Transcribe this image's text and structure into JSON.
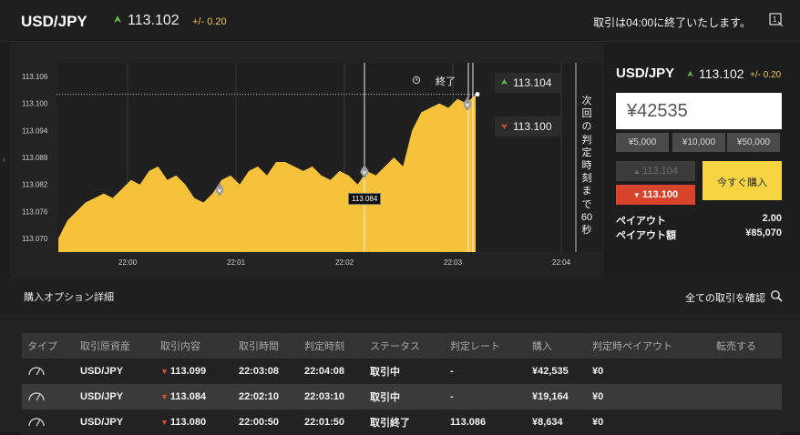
{
  "header": {
    "pair": "USD/JPY",
    "price": "113.102",
    "change": "+/- 0.20",
    "notice": "取引は04:00に終了いたします。",
    "expand_icon": "expand-icon"
  },
  "chart": {
    "y_ticks": [
      "113.106",
      "113.100",
      "113.094",
      "113.088",
      "113.082",
      "113.076",
      "113.070"
    ],
    "x_ticks": [
      "22:00",
      "22:01",
      "22:02",
      "22:03",
      "22:04"
    ],
    "end_label": "終了",
    "high_price": "113.104",
    "low_price": "113.100",
    "countdown": "次回の判定時刻まで60秒",
    "tooltip": "113.084",
    "colors": {
      "area": "#f5c23a",
      "up": "#5cc24a",
      "down": "#e0472f"
    }
  },
  "chart_data": {
    "type": "area",
    "x_range": [
      "22:00",
      "22:04"
    ],
    "ylim": [
      113.067,
      113.109
    ],
    "y_ticks": [
      113.106,
      113.1,
      113.094,
      113.088,
      113.082,
      113.076,
      113.07
    ],
    "x_ticks": [
      "22:00",
      "22:01",
      "22:02",
      "22:03",
      "22:04"
    ],
    "series": [
      {
        "values": [
          113.07,
          113.074,
          113.076,
          113.078,
          113.079,
          113.08,
          113.079,
          113.081,
          113.083,
          113.082,
          113.085,
          113.086,
          113.083,
          113.084,
          113.082,
          113.079,
          113.078,
          113.08,
          113.083,
          113.084,
          113.082,
          113.085,
          113.086,
          113.084,
          113.087,
          113.087,
          113.086,
          113.085,
          113.086,
          113.084,
          113.083,
          113.085,
          113.084,
          113.082,
          113.085,
          113.084,
          113.086,
          113.088,
          113.086,
          113.094,
          113.098,
          113.099,
          113.1,
          113.099,
          113.101,
          113.1,
          113.102
        ]
      }
    ],
    "entry_markers": [
      {
        "time": "22:00:50",
        "rate": 113.08,
        "direction": "low"
      },
      {
        "time": "22:02:10",
        "rate": 113.084,
        "direction": "low"
      },
      {
        "time": "22:03:08",
        "rate": 113.099,
        "direction": "low"
      }
    ],
    "current_rate": 113.102
  },
  "trade": {
    "pair": "USD/JPY",
    "price": "113.102",
    "change": "+/- 0.20",
    "amount": "¥42535",
    "presets": [
      "¥5,000",
      "¥10,000",
      "¥50,000"
    ],
    "high_button": "113.104",
    "low_button": "113.100",
    "buy_button": "今すぐ購入",
    "payout_label": "ペイアウト",
    "payout_value": "2.00",
    "payout_amount_label": "ペイアウト額",
    "payout_amount_value": "¥85,070"
  },
  "history": {
    "title": "購入オプション詳細",
    "view_all": "全ての取引を確認",
    "columns": [
      "タイプ",
      "取引原資産",
      "取引内容",
      "取引時間",
      "判定時刻",
      "ステータス",
      "判定レート",
      "購入",
      "判定時ペイアウト",
      "転売する"
    ],
    "rows": [
      {
        "asset": "USD/JPY",
        "content": "113.099",
        "time": "22:03:08",
        "judge": "22:04:08",
        "status": "取引中",
        "rate": "-",
        "purchase": "¥42,535",
        "payout": "¥0",
        "resell": ""
      },
      {
        "asset": "USD/JPY",
        "content": "113.084",
        "time": "22:02:10",
        "judge": "22:03:10",
        "status": "取引中",
        "rate": "-",
        "purchase": "¥19,164",
        "payout": "¥0",
        "resell": ""
      },
      {
        "asset": "USD/JPY",
        "content": "113.080",
        "time": "22:00:50",
        "judge": "22:01:50",
        "status": "取引終了",
        "rate": "113.086",
        "purchase": "¥8,634",
        "payout": "¥0",
        "resell": ""
      }
    ]
  }
}
